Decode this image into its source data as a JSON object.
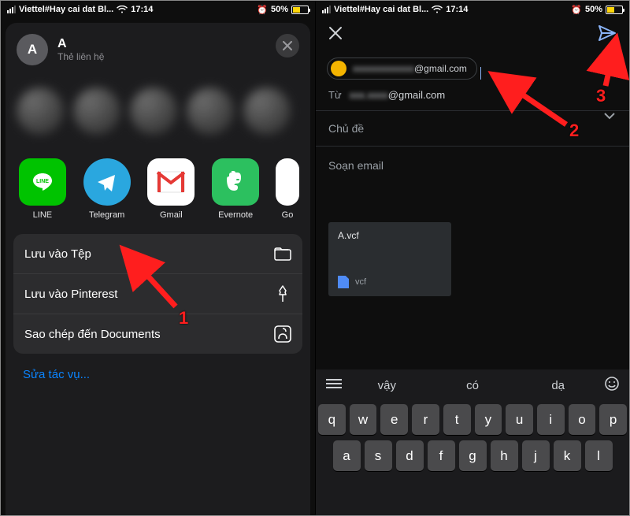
{
  "status": {
    "carrier": "Viettel#Hay cai dat Bl...",
    "time": "17:14",
    "battery_pct": "50%"
  },
  "share": {
    "contact_initial": "A",
    "contact_name": "A",
    "contact_sub": "Thẻ liên hệ",
    "apps": {
      "line": "LINE",
      "telegram": "Telegram",
      "gmail": "Gmail",
      "evernote": "Evernote",
      "google": "Go"
    },
    "actions": {
      "save_files": "Lưu vào Tệp",
      "save_pinterest": "Lưu vào Pinterest",
      "copy_docs": "Sao chép đến Documents"
    },
    "edit": "Sửa tác vụ..."
  },
  "compose": {
    "to_suffix": "@gmail.com",
    "from_label": "Từ",
    "from_suffix": "@gmail.com",
    "subject_placeholder": "Chủ đề",
    "body_placeholder": "Soạn email",
    "attachment_name": "A.vcf",
    "attachment_type": "vcf"
  },
  "keyboard": {
    "suggestions": [
      "vậy",
      "có",
      "dạ"
    ],
    "row1": [
      "q",
      "w",
      "e",
      "r",
      "t",
      "y",
      "u",
      "i",
      "o",
      "p"
    ],
    "row2": [
      "a",
      "s",
      "d",
      "f",
      "g",
      "h",
      "j",
      "k",
      "l"
    ]
  },
  "annot": {
    "n1": "1",
    "n2": "2",
    "n3": "3"
  }
}
